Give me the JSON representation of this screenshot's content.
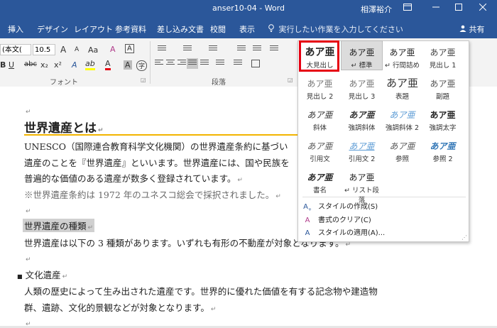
{
  "window": {
    "title": "anser10-04  -  Word",
    "user": "相澤裕介"
  },
  "tabs": [
    "挿入",
    "デザイン",
    "レイアウト",
    "参考資料",
    "差し込み文書",
    "校閲",
    "表示"
  ],
  "tell_me": "実行したい作業を入力してください",
  "share": "共有",
  "ribbon": {
    "font_name": "(本文(",
    "font_size": "10.5",
    "font_group_label": "フォント",
    "paragraph_group_label": "段落",
    "btn_a_big": "A",
    "btn_a_small": "A",
    "btn_aa": "Aa",
    "btn_clear": "A",
    "btn_char_a": "A",
    "btn_bold": "B",
    "btn_underline": "U",
    "btn_strike": "abc",
    "btn_sub": "x₂",
    "btn_sup": "x²",
    "btn_effects": "A",
    "btn_highlight": "ab",
    "btn_fontcolor": "A",
    "btn_shade": "A",
    "btn_border": "A",
    "btn_enclose": "字"
  },
  "styles": [
    {
      "sample": "あア亜",
      "name": "大見出し",
      "color": "#222222",
      "bold": true
    },
    {
      "sample": "あア亜",
      "name": "↵ 標準",
      "color": "#222222",
      "bold": false
    },
    {
      "sample": "あア亜",
      "name": "↵ 行間詰め",
      "color": "#222222",
      "bold": false
    },
    {
      "sample": "あア亜",
      "name": "見出し 1",
      "color": "#444444",
      "bold": false
    },
    {
      "sample": "あア亜",
      "name": "見出し 2",
      "color": "#777777",
      "bold": false
    },
    {
      "sample": "あア亜",
      "name": "見出し 3",
      "color": "#777777",
      "bold": false
    },
    {
      "sample": "あア亜",
      "name": "表題",
      "color": "#333333",
      "bold": false
    },
    {
      "sample": "あア亜",
      "name": "副題",
      "color": "#555555",
      "bold": false
    },
    {
      "sample": "あア亜",
      "name": "斜体",
      "color": "#333333",
      "bold": false
    },
    {
      "sample": "あア亜",
      "name": "強調斜体",
      "color": "#333333",
      "bold": true
    },
    {
      "sample": "あア亜",
      "name": "強調斜体 2",
      "color": "#5b9bd5",
      "bold": false
    },
    {
      "sample": "あア亜",
      "name": "強調太字",
      "color": "#222222",
      "bold": true
    },
    {
      "sample": "あア亜",
      "name": "引用文",
      "color": "#555555",
      "bold": false
    },
    {
      "sample": "あア亜",
      "name": "引用文 2",
      "color": "#5b9bd5",
      "bold": false
    },
    {
      "sample": "あア亜",
      "name": "参照",
      "color": "#555555",
      "bold": false
    },
    {
      "sample": "あア亜",
      "name": "参照 2",
      "color": "#2e74b5",
      "bold": true
    },
    {
      "sample": "あア亜",
      "name": "書名",
      "color": "#222222",
      "bold": true
    },
    {
      "sample": "あア亜",
      "name": "↵ リスト段落",
      "color": "#222222",
      "bold": false
    }
  ],
  "actions": [
    {
      "icon": "create-style-icon",
      "label": "スタイルの作成(S)"
    },
    {
      "icon": "clear-format-icon",
      "label": "書式のクリア(C)"
    },
    {
      "icon": "apply-style-icon",
      "label": "スタイルの適用(A)..."
    }
  ],
  "doc": {
    "heading": "世界遺産とは",
    "line1": "UNESCO（国際連合教育科学文化機関）の世界遺産条約に基づい",
    "line2": "遺産のことを『世界遺産』といいます。世界遺産には、国や民族を",
    "line3": "普遍的な価値のある遺産が数多く登録されています。",
    "line4": "※世界遺産条約は 1972 年のユネスコ総会で採択されました。",
    "sub_heading": "世界遺産の種類",
    "line5": "世界遺産は以下の 3 種類があります。いずれも有形の不動産が対象となります。",
    "bullet": "文化遺産",
    "line6": "人類の歴史によって生み出された遺産です。世界的に優れた価値を有する記念物や建造物",
    "line7": "群、遺跡、文化的景観などが対象となります。",
    "para_mark": "↵"
  },
  "colors": {
    "titlebar": "#2b579a",
    "accent": "#e60012",
    "heading_rule": "#f2b400"
  }
}
